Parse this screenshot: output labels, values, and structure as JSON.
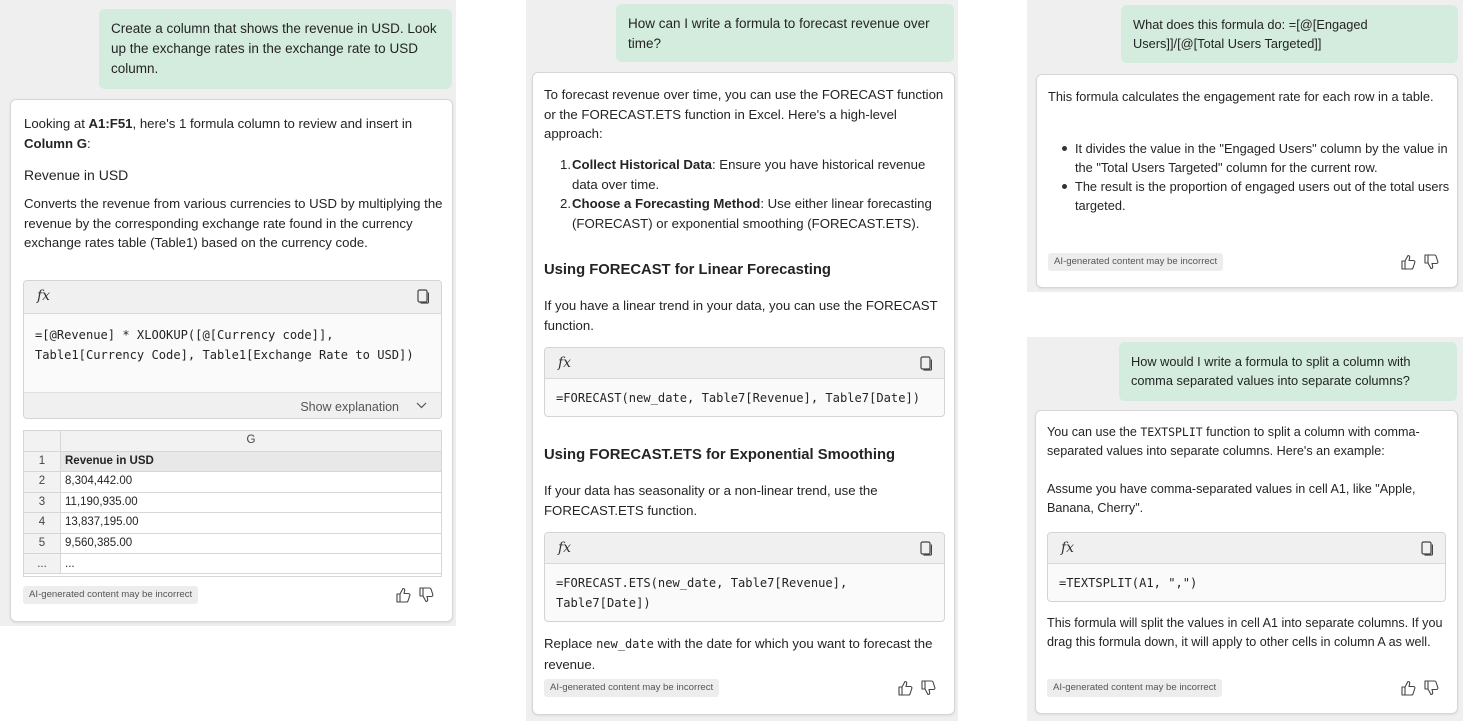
{
  "panel1": {
    "prompt": "Create a column that shows the revenue in USD. Look up the exchange rates in the exchange rate to USD column.",
    "intro_pre": "Looking at ",
    "intro_range": "A1:F51",
    "intro_mid": ", here's 1 formula column to review and insert in ",
    "intro_column": "Column G",
    "intro_post": ":",
    "column_title": "Revenue in USD",
    "description": "Converts the revenue from various currencies to USD by multiplying the revenue by the corresponding exchange rate found in the currency exchange rates table (Table1) based on the currency code.",
    "fx_label": "fx",
    "formula": "=[@Revenue] * XLOOKUP([@[Currency code]], Table1[Currency Code], Table1[Exchange Rate to USD])",
    "show_explanation": "Show explanation",
    "table": {
      "column_letter": "G",
      "rows": [
        {
          "num": "1",
          "value": "Revenue in USD"
        },
        {
          "num": "2",
          "value": "8,304,442.00"
        },
        {
          "num": "3",
          "value": "11,190,935.00"
        },
        {
          "num": "4",
          "value": "13,837,195.00"
        },
        {
          "num": "5",
          "value": "9,560,385.00"
        },
        {
          "num": "...",
          "value": "..."
        }
      ]
    },
    "disclaimer": "AI-generated content may be incorrect"
  },
  "panel2": {
    "prompt": "How can I write a formula to forecast revenue over time?",
    "intro": "To forecast revenue over time, you can use the FORECAST function or the FORECAST.ETS function in Excel. Here's a high-level approach:",
    "steps": [
      {
        "num": "1.",
        "title": "Collect Historical Data",
        "text": ": Ensure you have historical revenue data over time."
      },
      {
        "num": "2.",
        "title": "Choose a Forecasting Method",
        "text": ": Use either linear forecasting (FORECAST) or exponential smoothing (FORECAST.ETS)."
      }
    ],
    "section1_title": "Using FORECAST for Linear Forecasting",
    "section1_text": "If you have a linear trend in your data, you can use the FORECAST function.",
    "fx_label": "fx",
    "formula1": "=FORECAST(new_date, Table7[Revenue], Table7[Date])",
    "section2_title": "Using FORECAST.ETS for Exponential Smoothing",
    "section2_text": "If your data has seasonality or a non-linear trend, use the FORECAST.ETS function.",
    "formula2": "=FORECAST.ETS(new_date, Table7[Revenue], Table7[Date])",
    "replace_pre": "Replace ",
    "replace_code": "new_date",
    "replace_post": " with the date for which you want to forecast the revenue.",
    "disclaimer": "AI-generated content may be incorrect"
  },
  "panel3": {
    "prompt": "What does this formula do: =[@[Engaged Users]]/[@[Total Users Targeted]]",
    "intro": "This formula calculates the engagement rate for each row in a table.",
    "bullets": [
      "It divides the value in the \"Engaged Users\" column by the value in the \"Total Users Targeted\" column for the current row.",
      "The result is the proportion of engaged users out of the total users targeted."
    ],
    "disclaimer": "AI-generated content may be incorrect"
  },
  "panel4": {
    "prompt": "How would I write a formula to split a column with comma separated values into separate columns?",
    "intro_pre": "You can use the ",
    "intro_code": "TEXTSPLIT",
    "intro_post": " function to split a column with comma-separated values into separate columns. Here's an example:",
    "assume": "Assume you have comma-separated values in cell A1, like \"Apple, Banana, Cherry\".",
    "fx_label": "fx",
    "formula": "=TEXTSPLIT(A1, \",\")",
    "outro": "This formula will split the values in cell A1 into separate columns. If you drag this formula down, it will apply to other cells in column A as well.",
    "disclaimer": "AI-generated content may be incorrect"
  },
  "icons": [
    "fx-icon",
    "copy-icon",
    "chevron-down-icon",
    "thumbs-up-icon",
    "thumbs-down-icon"
  ]
}
